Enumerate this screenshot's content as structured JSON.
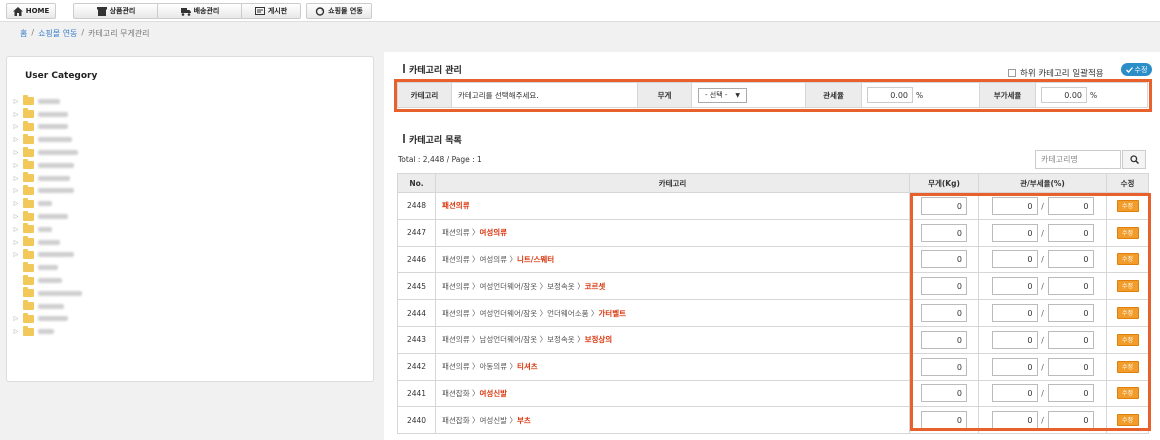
{
  "nav": {
    "items": [
      {
        "label": "HOME",
        "icon": "home-icon"
      },
      {
        "label": "상품관리",
        "icon": "box-icon"
      },
      {
        "label": "배송관리",
        "icon": "truck-icon"
      },
      {
        "label": "게시판",
        "icon": "board-icon"
      },
      {
        "label": "쇼핑몰 연동",
        "icon": "sync-icon"
      }
    ]
  },
  "breadcrumb": {
    "home": "홈",
    "sep1": "/",
    "section": "쇼핑몰 연동",
    "sep2": "/",
    "current": "카테고리 무게관리"
  },
  "sidebar": {
    "title": "User Category",
    "tree_count": 19
  },
  "manage": {
    "title": "카테고리 관리",
    "apply_sub_label": "하위 카테고리 일괄적용",
    "edit_label": "수정",
    "category_label": "카테고리",
    "category_value": "카테고리를 선택해주세요.",
    "weight_label": "무게",
    "weight_select": "- 선택 -",
    "duty_label": "관세율",
    "duty_value": "0.00",
    "duty_unit": "%",
    "vat_label": "부가세율",
    "vat_value": "0.00",
    "vat_unit": "%"
  },
  "list": {
    "title": "카테고리 목록",
    "total": "Total : 2,448 / Page : 1",
    "search_placeholder": "카테고리명",
    "headers": {
      "no": "No.",
      "category": "카테고리",
      "weight": "무게(Kg)",
      "tax": "관/부세율(%)",
      "edit": "수정"
    },
    "rows": [
      {
        "no": "2448",
        "path": "",
        "last": "패션의류",
        "weight": "0",
        "duty": "0",
        "vat": "0",
        "edit": "수정"
      },
      {
        "no": "2447",
        "path": "패션의류 〉",
        "last": "여성의류",
        "weight": "0",
        "duty": "0",
        "vat": "0",
        "edit": "수정"
      },
      {
        "no": "2446",
        "path": "패션의류 〉여성의류 〉",
        "last": "니트/스웨터",
        "weight": "0",
        "duty": "0",
        "vat": "0",
        "edit": "수정"
      },
      {
        "no": "2445",
        "path": "패션의류 〉여성언더웨어/잠옷 〉보정속옷 〉",
        "last": "코르셋",
        "weight": "0",
        "duty": "0",
        "vat": "0",
        "edit": "수정"
      },
      {
        "no": "2444",
        "path": "패션의류 〉여성언더웨어/잠옷 〉언더웨어소품 〉",
        "last": "가터벨트",
        "weight": "0",
        "duty": "0",
        "vat": "0",
        "edit": "수정"
      },
      {
        "no": "2443",
        "path": "패션의류 〉남성언더웨어/잠옷 〉보정속옷 〉",
        "last": "보정상의",
        "weight": "0",
        "duty": "0",
        "vat": "0",
        "edit": "수정"
      },
      {
        "no": "2442",
        "path": "패션의류 〉아동의류 〉",
        "last": "티셔츠",
        "weight": "0",
        "duty": "0",
        "vat": "0",
        "edit": "수정"
      },
      {
        "no": "2441",
        "path": "패션잡화 〉",
        "last": "여성신발",
        "weight": "0",
        "duty": "0",
        "vat": "0",
        "edit": "수정"
      },
      {
        "no": "2440",
        "path": "패션잡화 〉여성신발 〉",
        "last": "부츠",
        "weight": "0",
        "duty": "0",
        "vat": "0",
        "edit": "수정"
      }
    ]
  },
  "colors": {
    "accent": "#e8602c",
    "link": "#3a7fcb",
    "edit_button": "#f29d2b",
    "highlight_text": "#d9360e"
  }
}
